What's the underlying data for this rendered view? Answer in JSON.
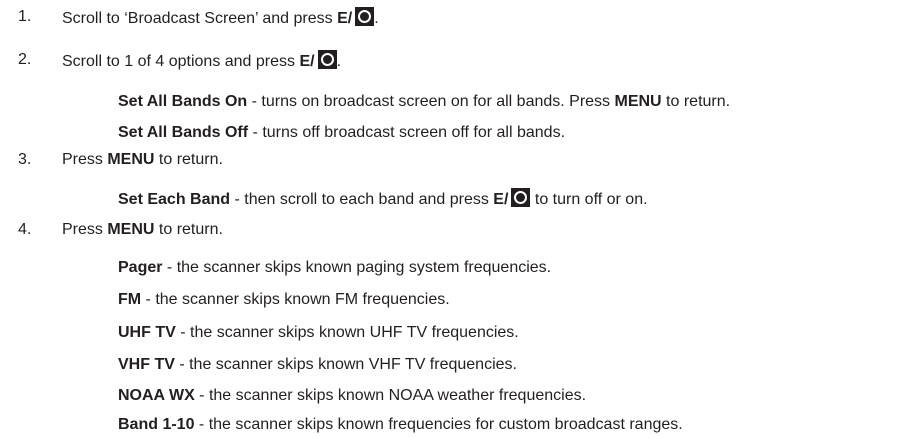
{
  "steps": [
    {
      "number": "1.",
      "before": "Scroll to ‘Broadcast Screen’ and press ",
      "key": "E/",
      "after": "."
    },
    {
      "number": "2.",
      "before": "Scroll to 1 of 4 options and press ",
      "key": "E/",
      "after": "."
    },
    {
      "number": "3.",
      "before": "Press ",
      "key": "MENU",
      "after": " to return."
    },
    {
      "number": "4.",
      "before": "Press ",
      "key": "MENU",
      "after": " to return."
    }
  ],
  "options": {
    "set_all_on": {
      "term": "Set All Bands On",
      "text": " - turns on broadcast screen on for all bands. Press ",
      "key": "MENU",
      "after": " to return."
    },
    "set_all_off": {
      "term": "Set All Bands Off",
      "text": " - turns off broadcast screen off for all bands."
    },
    "set_each": {
      "term": "Set Each Band",
      "text": " - then scroll to each band and press ",
      "key": "E/",
      "after": " to turn off or on."
    }
  },
  "bands": [
    {
      "term": "Pager",
      "text": " - the scanner skips known paging system frequencies."
    },
    {
      "term": "FM",
      "text": " - the scanner skips known FM frequencies."
    },
    {
      "term": "UHF TV",
      "text": " - the scanner skips known UHF TV frequencies."
    },
    {
      "term": "VHF TV",
      "text": " - the scanner skips known VHF TV frequencies."
    },
    {
      "term": "NOAA WX",
      "text": " - the scanner skips known NOAA weather frequencies."
    },
    {
      "term": "Band 1-10",
      "text": " - the scanner skips known frequencies for custom broadcast ranges."
    }
  ],
  "icons": {
    "enter_key": "circle-button-icon"
  },
  "colors": {
    "text": "#231f20",
    "background": "#ffffff"
  }
}
